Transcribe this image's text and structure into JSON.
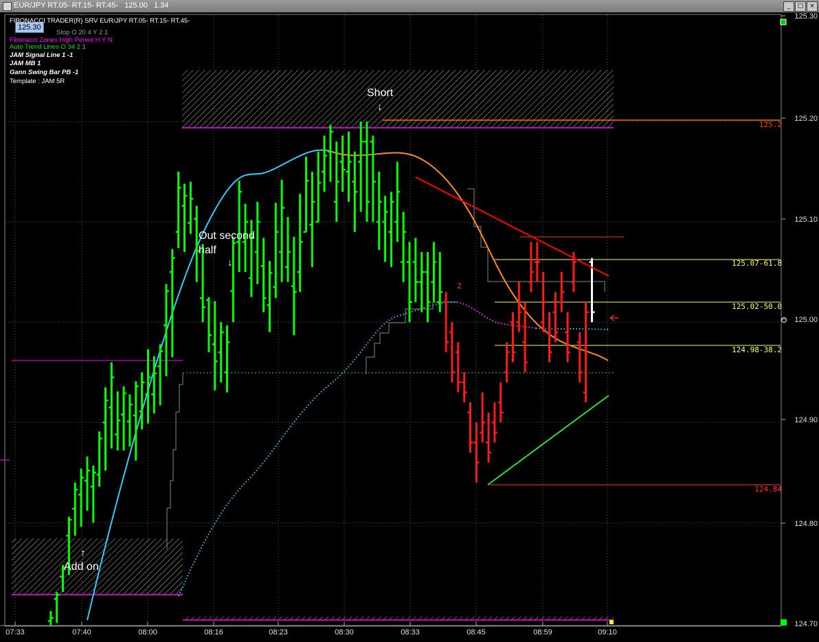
{
  "window": {
    "title": "EUR/JPY RT.05- RT.15- RT.45-   125.00   1.34",
    "last_price": "125.30"
  },
  "legend": {
    "header": "FIBONACCI TRADER(R) SRV    EUR/JPY RT.05- RT.15- RT.45-",
    "line1": "Stop O 20 4 Y 2 1",
    "line2": "Fibonacci Zones High Period H Y N",
    "line3": "Auto Trend Lines O 34 2 1",
    "line4": "JAM Signal Line 1 -1",
    "line5": "JAM MB 1",
    "line6": "Gann Swing Bar PB -1",
    "line7": "Template : JAM 5R"
  },
  "annotations": {
    "short": "Short",
    "out_second_half": "Out second half",
    "add_on": "Add on",
    "arrow_down": "↓",
    "arrow_up": "↑"
  },
  "colors": {
    "up_bar": "#00ff00",
    "down_bar": "#ff1a1a",
    "fast_ma": "#33ccff",
    "ma_turn": "#ff8c1a",
    "fib_line": "#ffff66",
    "zone": "#ff00ff",
    "resistance": "#ff0000",
    "support": "#33dd33"
  },
  "chart_data": {
    "type": "ohlc",
    "title": "EUR/JPY RT.05- RT.15- RT.45-",
    "ylim": [
      124.7,
      125.3
    ],
    "y_ticks": [
      "125.30",
      "125.20",
      "125.10",
      "125.00",
      "124.90",
      "124.80",
      "124.70"
    ],
    "x_ticks": [
      "07:33",
      "07:40",
      "08:00",
      "08:16",
      "08:23",
      "08:30",
      "08:33",
      "08:45",
      "08:59",
      "09:10"
    ],
    "current_price_label": "125.00",
    "levels": [
      {
        "label": "125.2",
        "value": 125.197,
        "color": "#ff4500"
      },
      {
        "label": "125.07-61.8",
        "value": 125.064,
        "color": "#ffff66"
      },
      {
        "label": "125.02-50.0",
        "value": 125.022,
        "color": "#ffff66"
      },
      {
        "label": "124.98-38.2",
        "value": 124.979,
        "color": "#ffff66"
      },
      {
        "label": "124.84",
        "value": 124.84,
        "color": "#ff3030"
      }
    ],
    "bars": [
      {
        "i": 1,
        "o": 124.702,
        "h": 124.712,
        "l": 124.698,
        "c": 124.705
      },
      {
        "i": 2,
        "o": 124.724,
        "h": 124.731,
        "l": 124.7,
        "c": 124.728
      },
      {
        "i": 3,
        "o": 124.746,
        "h": 124.758,
        "l": 124.731,
        "c": 124.755
      },
      {
        "i": 4,
        "o": 124.787,
        "h": 124.806,
        "l": 124.748,
        "c": 124.803
      },
      {
        "i": 5,
        "o": 124.814,
        "h": 124.84,
        "l": 124.787,
        "c": 124.833
      },
      {
        "i": 6,
        "o": 124.828,
        "h": 124.854,
        "l": 124.796,
        "c": 124.845
      },
      {
        "i": 7,
        "o": 124.842,
        "h": 124.866,
        "l": 124.812,
        "c": 124.852
      },
      {
        "i": 8,
        "o": 124.836,
        "h": 124.857,
        "l": 124.8,
        "c": 124.85
      },
      {
        "i": 9,
        "o": 124.848,
        "h": 124.891,
        "l": 124.836,
        "c": 124.884
      },
      {
        "i": 10,
        "o": 124.9,
        "h": 124.935,
        "l": 124.852,
        "c": 124.922
      },
      {
        "i": 11,
        "o": 124.915,
        "h": 124.96,
        "l": 124.874,
        "c": 124.945
      },
      {
        "i": 12,
        "o": 124.888,
        "h": 124.931,
        "l": 124.872,
        "c": 124.902
      },
      {
        "i": 13,
        "o": 124.908,
        "h": 124.936,
        "l": 124.872,
        "c": 124.929
      },
      {
        "i": 14,
        "o": 124.901,
        "h": 124.928,
        "l": 124.876,
        "c": 124.918
      },
      {
        "i": 15,
        "o": 124.907,
        "h": 124.941,
        "l": 124.862,
        "c": 124.936
      },
      {
        "i": 16,
        "o": 124.911,
        "h": 124.95,
        "l": 124.893,
        "c": 124.94
      },
      {
        "i": 17,
        "o": 124.928,
        "h": 124.973,
        "l": 124.899,
        "c": 124.945
      },
      {
        "i": 18,
        "o": 124.928,
        "h": 124.966,
        "l": 124.909,
        "c": 124.949
      },
      {
        "i": 19,
        "o": 124.956,
        "h": 124.978,
        "l": 124.917,
        "c": 124.971
      },
      {
        "i": 20,
        "o": 124.997,
        "h": 125.038,
        "l": 124.946,
        "c": 125.031
      },
      {
        "i": 21,
        "o": 125.05,
        "h": 125.073,
        "l": 124.965,
        "c": 125.064
      },
      {
        "i": 22,
        "o": 125.09,
        "h": 125.15,
        "l": 125.074,
        "c": 125.134
      },
      {
        "i": 23,
        "o": 125.116,
        "h": 125.138,
        "l": 125.07,
        "c": 125.126
      },
      {
        "i": 24,
        "o": 125.099,
        "h": 125.14,
        "l": 125.088,
        "c": 125.123
      },
      {
        "i": 25,
        "o": 125.103,
        "h": 125.116,
        "l": 125.04,
        "c": 125.071
      },
      {
        "i": 26,
        "o": 125.024,
        "h": 125.078,
        "l": 125.0,
        "c": 125.015
      },
      {
        "i": 27,
        "o": 125.022,
        "h": 125.025,
        "l": 124.97,
        "c": 124.987
      },
      {
        "i": 28,
        "o": 124.978,
        "h": 125.021,
        "l": 124.932,
        "c": 124.961
      },
      {
        "i": 29,
        "o": 124.97,
        "h": 125.0,
        "l": 124.94,
        "c": 124.99
      },
      {
        "i": 30,
        "o": 124.95,
        "h": 124.997,
        "l": 124.93,
        "c": 124.98
      },
      {
        "i": 31,
        "o": 125.031,
        "h": 125.085,
        "l": 125.0,
        "c": 125.079
      },
      {
        "i": 32,
        "o": 125.08,
        "h": 125.141,
        "l": 125.05,
        "c": 125.13
      },
      {
        "i": 33,
        "o": 125.08,
        "h": 125.118,
        "l": 125.05,
        "c": 125.1
      },
      {
        "i": 34,
        "o": 125.044,
        "h": 125.102,
        "l": 125.025,
        "c": 125.085
      },
      {
        "i": 35,
        "o": 125.07,
        "h": 125.12,
        "l": 125.038,
        "c": 125.1
      },
      {
        "i": 36,
        "o": 125.056,
        "h": 125.084,
        "l": 125.01,
        "c": 125.024
      },
      {
        "i": 37,
        "o": 125.017,
        "h": 125.061,
        "l": 124.99,
        "c": 125.049
      },
      {
        "i": 38,
        "o": 125.035,
        "h": 125.119,
        "l": 125.024,
        "c": 125.09
      },
      {
        "i": 39,
        "o": 125.07,
        "h": 125.142,
        "l": 125.04,
        "c": 125.114
      },
      {
        "i": 40,
        "o": 125.055,
        "h": 125.105,
        "l": 125.04,
        "c": 125.07
      },
      {
        "i": 41,
        "o": 125.036,
        "h": 125.085,
        "l": 124.987,
        "c": 125.03
      },
      {
        "i": 42,
        "o": 125.05,
        "h": 125.128,
        "l": 125.03,
        "c": 125.08
      },
      {
        "i": 43,
        "o": 125.09,
        "h": 125.165,
        "l": 125.09,
        "c": 125.141
      },
      {
        "i": 44,
        "o": 125.097,
        "h": 125.15,
        "l": 125.055,
        "c": 125.12
      },
      {
        "i": 45,
        "o": 125.1,
        "h": 125.17,
        "l": 125.1,
        "c": 125.139
      },
      {
        "i": 46,
        "o": 125.15,
        "h": 125.186,
        "l": 125.13,
        "c": 125.166
      },
      {
        "i": 47,
        "o": 125.17,
        "h": 125.197,
        "l": 125.14,
        "c": 125.19
      },
      {
        "i": 48,
        "o": 125.12,
        "h": 125.18,
        "l": 125.1,
        "c": 125.14
      },
      {
        "i": 49,
        "o": 125.16,
        "h": 125.186,
        "l": 125.13,
        "c": 125.152
      },
      {
        "i": 50,
        "o": 125.15,
        "h": 125.19,
        "l": 125.12,
        "c": 125.16
      },
      {
        "i": 51,
        "o": 125.14,
        "h": 125.17,
        "l": 125.09,
        "c": 125.13
      },
      {
        "i": 52,
        "o": 125.16,
        "h": 125.2,
        "l": 125.11,
        "c": 125.18
      },
      {
        "i": 53,
        "o": 125.18,
        "h": 125.2,
        "l": 125.1,
        "c": 125.12
      },
      {
        "i": 54,
        "o": 125.18,
        "h": 125.186,
        "l": 125.1,
        "c": 125.14
      },
      {
        "i": 55,
        "o": 125.1,
        "h": 125.15,
        "l": 125.072,
        "c": 125.12
      },
      {
        "i": 56,
        "o": 125.1,
        "h": 125.126,
        "l": 125.06,
        "c": 125.11
      },
      {
        "i": 57,
        "o": 125.09,
        "h": 125.13,
        "l": 125.055,
        "c": 125.12
      },
      {
        "i": 58,
        "o": 125.1,
        "h": 125.16,
        "l": 125.08,
        "c": 125.13
      },
      {
        "i": 59,
        "o": 125.06,
        "h": 125.11,
        "l": 125.04,
        "c": 125.09
      },
      {
        "i": 60,
        "o": 125.06,
        "h": 125.08,
        "l": 125.0,
        "c": 125.02
      },
      {
        "i": 61,
        "o": 125.06,
        "h": 125.084,
        "l": 125.02,
        "c": 125.04
      },
      {
        "i": 62,
        "o": 125.04,
        "h": 125.07,
        "l": 125.01,
        "c": 125.05
      },
      {
        "i": 63,
        "o": 125.05,
        "h": 125.07,
        "l": 125.0,
        "c": 125.02
      },
      {
        "i": 64,
        "o": 125.04,
        "h": 125.08,
        "l": 125.02,
        "c": 125.06
      },
      {
        "i": 65,
        "o": 125.02,
        "h": 125.07,
        "l": 125.01,
        "c": 125.03
      },
      {
        "i": 66,
        "o": 125.02,
        "h": 125.03,
        "l": 124.97,
        "c": 124.98
      },
      {
        "i": 67,
        "o": 124.99,
        "h": 125.0,
        "l": 124.94,
        "c": 124.95
      },
      {
        "i": 68,
        "o": 124.97,
        "h": 124.98,
        "l": 124.93,
        "c": 124.94
      },
      {
        "i": 69,
        "o": 124.94,
        "h": 124.95,
        "l": 124.92,
        "c": 124.93
      },
      {
        "i": 70,
        "o": 124.91,
        "h": 124.92,
        "l": 124.87,
        "c": 124.88
      },
      {
        "i": 71,
        "o": 124.88,
        "h": 124.9,
        "l": 124.84,
        "c": 124.86
      },
      {
        "i": 72,
        "o": 124.89,
        "h": 124.93,
        "l": 124.88,
        "c": 124.9
      },
      {
        "i": 73,
        "o": 124.88,
        "h": 124.91,
        "l": 124.86,
        "c": 124.87
      },
      {
        "i": 74,
        "o": 124.9,
        "h": 124.92,
        "l": 124.88,
        "c": 124.89
      },
      {
        "i": 75,
        "o": 124.92,
        "h": 124.94,
        "l": 124.9,
        "c": 124.91
      },
      {
        "i": 76,
        "o": 124.95,
        "h": 124.98,
        "l": 124.94,
        "c": 124.97
      },
      {
        "i": 77,
        "o": 125.0,
        "h": 125.01,
        "l": 124.96,
        "c": 124.97
      },
      {
        "i": 78,
        "o": 125.0,
        "h": 125.04,
        "l": 124.99,
        "c": 125.01
      },
      {
        "i": 79,
        "o": 124.98,
        "h": 125.02,
        "l": 124.95,
        "c": 124.96
      },
      {
        "i": 80,
        "o": 125.04,
        "h": 125.08,
        "l": 125.03,
        "c": 125.05
      },
      {
        "i": 81,
        "o": 125.06,
        "h": 125.08,
        "l": 125.04,
        "c": 125.06
      },
      {
        "i": 82,
        "o": 125.0,
        "h": 125.05,
        "l": 124.99,
        "c": 125.02
      },
      {
        "i": 83,
        "o": 124.99,
        "h": 125.01,
        "l": 124.96,
        "c": 124.97
      },
      {
        "i": 84,
        "o": 125.01,
        "h": 125.03,
        "l": 124.98,
        "c": 124.99
      },
      {
        "i": 85,
        "o": 125.02,
        "h": 125.05,
        "l": 125.01,
        "c": 125.03
      },
      {
        "i": 86,
        "o": 124.99,
        "h": 125.01,
        "l": 124.96,
        "c": 124.97
      },
      {
        "i": 87,
        "o": 125.04,
        "h": 125.07,
        "l": 125.03,
        "c": 125.06
      },
      {
        "i": 88,
        "o": 124.98,
        "h": 124.99,
        "l": 124.94,
        "c": 124.95
      },
      {
        "i": 89,
        "o": 124.93,
        "h": 125.02,
        "l": 124.92,
        "c": 125.01
      },
      {
        "i": 90,
        "o": 125.06,
        "h": 125.064,
        "l": 125.0,
        "c": 125.01
      }
    ]
  }
}
